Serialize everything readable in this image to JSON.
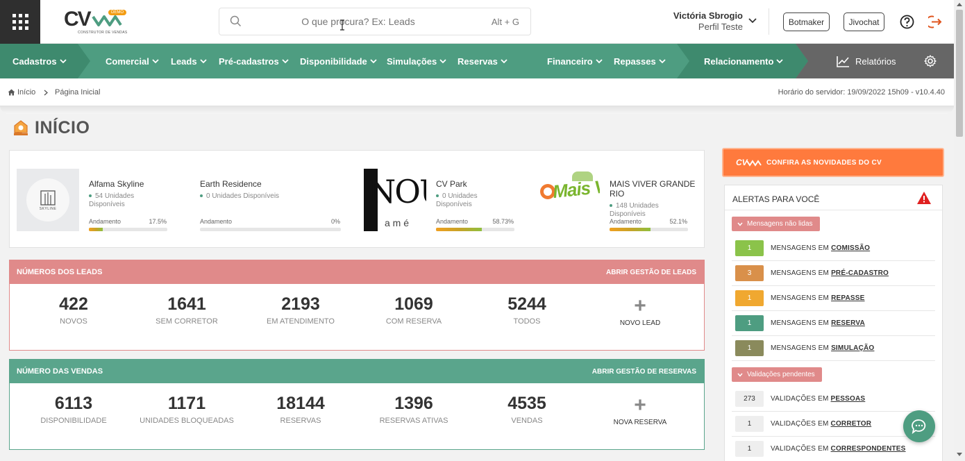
{
  "app": {
    "logo_text": "CV",
    "logo_badge": "DEMO",
    "logo_subtitle": "CONSTRUTOR DE VENDAS"
  },
  "search": {
    "placeholder": "O que procura? Ex: Leads",
    "shortcut": "Alt + G"
  },
  "user": {
    "name": "Victória Sbrogio",
    "profile": "Perfil Teste"
  },
  "header_buttons": {
    "botmaker": "Botmaker",
    "jivochat": "Jivochat"
  },
  "nav": {
    "items": [
      {
        "label": "Cadastros"
      },
      {
        "label": "Comercial"
      },
      {
        "label": "Leads"
      },
      {
        "label": "Pré-cadastros"
      },
      {
        "label": "Disponibilidade"
      },
      {
        "label": "Simulações"
      },
      {
        "label": "Reservas"
      },
      {
        "label": "Financeiro"
      },
      {
        "label": "Repasses"
      },
      {
        "label": "Relacionamento"
      },
      {
        "label": "Relatórios"
      }
    ],
    "colors": {
      "main": "#4e9d81",
      "dark": "#3e8a6e",
      "gray": "#666666"
    }
  },
  "breadcrumb": {
    "home": "Início",
    "current": "Página Inicial",
    "server_time": "Horário do servidor: 19/09/2022 15h09 - v10.4.40"
  },
  "page": {
    "title": "INÍCIO"
  },
  "projects": [
    {
      "name": "Alfama Skyline",
      "units": "54 Unidades Disponíveis",
      "progress_label": "Andamento",
      "progress": "17.5%",
      "progress_value": 17.5,
      "thumb_text": "SKYLINE"
    },
    {
      "name": "Earth Residence",
      "units": "0 Unidades Disponíveis",
      "progress_label": "Andamento",
      "progress": "0%",
      "progress_value": 0
    },
    {
      "name": "CV Park",
      "units": "0 Unidades Disponíveis",
      "progress_label": "Andamento",
      "progress": "58.73%",
      "progress_value": 58.73,
      "thumb_text": "NOU",
      "thumb_sub": "a m é"
    },
    {
      "name": "MAIS VIVER GRANDE RIO",
      "units": "148 Unidades Disponíveis",
      "progress_label": "Andamento",
      "progress": "52.1%",
      "progress_value": 52.1,
      "thumb_text": "Mais Viver"
    }
  ],
  "leads": {
    "title": "NÚMEROS DOS LEADS",
    "link": "ABRIR GESTÃO DE LEADS",
    "color": "#e08a8a",
    "stats": [
      {
        "value": "422",
        "label": "NOVOS"
      },
      {
        "value": "1641",
        "label": "SEM CORRETOR"
      },
      {
        "value": "2193",
        "label": "EM ATENDIMENTO"
      },
      {
        "value": "1069",
        "label": "COM RESERVA"
      },
      {
        "value": "5244",
        "label": "TODOS"
      }
    ],
    "add_label": "NOVO LEAD",
    "add_symbol": "+"
  },
  "sales": {
    "title": "NÚMERO DAS VENDAS",
    "link": "ABRIR GESTÃO DE RESERVAS",
    "color": "#5aa58c",
    "stats": [
      {
        "value": "6113",
        "label": "DISPONIBILIDADE"
      },
      {
        "value": "1171",
        "label": "UNIDADES BLOQUEADAS"
      },
      {
        "value": "18144",
        "label": "RESERVAS"
      },
      {
        "value": "1396",
        "label": "RESERVAS ATIVAS"
      },
      {
        "value": "4535",
        "label": "VENDAS"
      }
    ],
    "add_label": "NOVA RESERVA",
    "add_symbol": "+"
  },
  "news": {
    "logo": "CV",
    "label": "CONFIRA AS NOVIDADES DO CV"
  },
  "alerts": {
    "title": "ALERTAS PARA VOCÊ",
    "groups": [
      {
        "label": "Mensagens não lidas",
        "rows": [
          {
            "count": "1",
            "prefix": "MENSAGENS EM ",
            "target": "COMISSÃO",
            "color": "#8bc34a"
          },
          {
            "count": "3",
            "prefix": "MENSAGENS EM ",
            "target": "PRÉ-CADASTRO",
            "color": "#d9904a"
          },
          {
            "count": "1",
            "prefix": "MENSAGENS EM ",
            "target": "REPASSE",
            "color": "#f0a830"
          },
          {
            "count": "1",
            "prefix": "MENSAGENS EM ",
            "target": "RESERVA",
            "color": "#4e9d81"
          },
          {
            "count": "1",
            "prefix": "MENSAGENS EM ",
            "target": "SIMULAÇÃO",
            "color": "#8a8a5c"
          }
        ]
      },
      {
        "label": "Validações pendentes",
        "rows": [
          {
            "count": "273",
            "prefix": "VALIDAÇÕES EM ",
            "target": "PESSOAS",
            "color": "#eeeeee"
          },
          {
            "count": "1",
            "prefix": "VALIDAÇÕES EM ",
            "target": "CORRETOR",
            "color": "#eeeeee"
          },
          {
            "count": "1",
            "prefix": "VALIDAÇÕES EM ",
            "target": "CORRESPONDENTES",
            "color": "#eeeeee"
          }
        ]
      }
    ]
  }
}
